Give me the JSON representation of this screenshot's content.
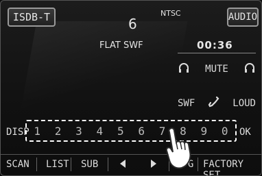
{
  "top": {
    "source_button": "ISDB-T",
    "audio_button": "AUDIO",
    "preset_number": "6",
    "video_standard": "NTSC"
  },
  "info": {
    "eq_label": "FLAT SWF",
    "time": "00:36"
  },
  "controls": {
    "mute": "MUTE",
    "swf": "SWF",
    "loud": "LOUD"
  },
  "keypad": {
    "disp": "DISP",
    "ok": "OK",
    "digits": [
      "1",
      "2",
      "3",
      "4",
      "5",
      "6",
      "7",
      "8",
      "9",
      "0"
    ]
  },
  "bottom": {
    "scan": "SCAN",
    "list": "LIST",
    "sub": "SUB",
    "prev_icon": "triangle-left-icon",
    "next_icon": "triangle-right-icon",
    "epg": "EPG",
    "factory_set": "FACTORY SET"
  }
}
